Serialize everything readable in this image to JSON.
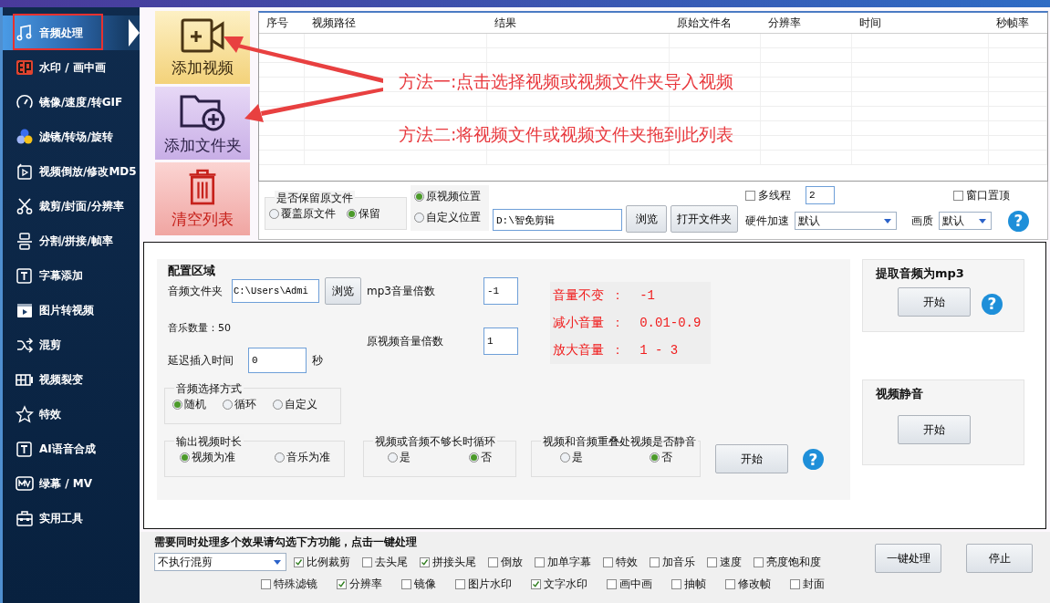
{
  "sidebar": {
    "highlight_selected": true,
    "items": [
      {
        "label": "音频处理",
        "selected": true
      },
      {
        "label": "水印 / 画中画",
        "selected": false
      },
      {
        "label": "镜像/速度/转GIF",
        "selected": false
      },
      {
        "label": "滤镜/转场/旋转",
        "selected": false
      },
      {
        "label": "视频倒放/修改MD5",
        "selected": false
      },
      {
        "label": "裁剪/封面/分辨率",
        "selected": false
      },
      {
        "label": "分割/拼接/帧率",
        "selected": false
      },
      {
        "label": "字幕添加",
        "selected": false
      },
      {
        "label": "图片转视频",
        "selected": false
      },
      {
        "label": "混剪",
        "selected": false
      },
      {
        "label": "视频裂变",
        "selected": false
      },
      {
        "label": "特效",
        "selected": false
      },
      {
        "label": "AI语音合成",
        "selected": false
      },
      {
        "label": "绿幕 / MV",
        "selected": false
      },
      {
        "label": "实用工具",
        "selected": false
      }
    ]
  },
  "actions": [
    {
      "label": "添加视频"
    },
    {
      "label": "添加文件夹"
    },
    {
      "label": "清空列表"
    }
  ],
  "table": {
    "columns": [
      "序号",
      "视频路径",
      "结果",
      "原始文件名",
      "分辨率",
      "时间",
      "秒帧率"
    ]
  },
  "annotations": [
    {
      "text": "方法一:点击选择视频或视频文件夹导入视频"
    },
    {
      "text": "方法二:将视频文件或视频文件夹拖到此列表"
    }
  ],
  "output_options": {
    "keep_original": {
      "title": "是否保留原文件",
      "options": [
        {
          "label": "覆盖原文件",
          "selected": false
        },
        {
          "label": "保留",
          "selected": true
        }
      ]
    },
    "location": {
      "options": [
        {
          "label": "原视频位置",
          "selected": true
        },
        {
          "label": "自定义位置",
          "selected": false
        }
      ],
      "path": "D:\\智免剪辑",
      "browse": "浏览",
      "open_folder": "打开文件夹"
    },
    "multithread": {
      "label": "多线程",
      "checked": false,
      "value": "2"
    },
    "window_top": {
      "label": "窗口置顶",
      "checked": false
    },
    "hw_accel": {
      "label": "硬件加速",
      "value": "默认"
    },
    "quality": {
      "label": "画质",
      "value": "默认"
    },
    "help": "?"
  },
  "config": {
    "title": "配置区域",
    "audio_folder": {
      "label": "音频文件夹",
      "value": "C:\\Users\\Admi",
      "browse": "浏览"
    },
    "music_count": "音乐数量：50",
    "delay": {
      "label": "延迟插入时间",
      "value": "0",
      "unit": "秒"
    },
    "mp3_volume": {
      "label": "mp3音量倍数",
      "value": "-1"
    },
    "orig_volume": {
      "label": "原视频音量倍数",
      "value": "1"
    },
    "volume_hints": [
      "音量不变 ：  -1",
      "减小音量 ：  0.01-0.9",
      "放大音量 ：  1 - 3"
    ],
    "audio_select": {
      "title": "音频选择方式",
      "options": [
        {
          "label": "随机",
          "selected": true
        },
        {
          "label": "循环",
          "selected": false
        },
        {
          "label": "自定义",
          "selected": false
        }
      ]
    },
    "output_duration": {
      "title": "输出视频时长",
      "options": [
        {
          "label": "视频为准",
          "selected": true
        },
        {
          "label": "音乐为准",
          "selected": false
        }
      ]
    },
    "loop_short": {
      "title": "视频或音频不够长时循环",
      "options": [
        {
          "label": "是",
          "selected": false
        },
        {
          "label": "否",
          "selected": true
        }
      ]
    },
    "mute_overlap": {
      "title": "视频和音频重叠处视频是否静音",
      "options": [
        {
          "label": "是",
          "selected": false
        },
        {
          "label": "否",
          "selected": true
        }
      ]
    },
    "start": "开始",
    "help": "?"
  },
  "extract_audio": {
    "title": "提取音频为mp3",
    "button": "开始",
    "help": "?"
  },
  "mute_video": {
    "title": "视频静音",
    "button": "开始"
  },
  "batch": {
    "hint": "需要同时处理多个效果请勾选下方功能，点击一键处理",
    "mix": "不执行混剪",
    "effects_row_1": [
      {
        "label": "比例裁剪",
        "checked": true
      },
      {
        "label": "去头尾",
        "checked": false
      },
      {
        "label": "拼接头尾",
        "checked": true
      },
      {
        "label": "倒放",
        "checked": false
      },
      {
        "label": "加单字幕",
        "checked": false
      },
      {
        "label": "特效",
        "checked": false
      },
      {
        "label": "加音乐",
        "checked": false
      },
      {
        "label": "速度",
        "checked": false
      },
      {
        "label": "亮度饱和度",
        "checked": false
      }
    ],
    "effects_row_2": [
      {
        "label": "特殊滤镜",
        "checked": false
      },
      {
        "label": "分辨率",
        "checked": true
      },
      {
        "label": "镜像",
        "checked": false
      },
      {
        "label": "图片水印",
        "checked": false
      },
      {
        "label": "文字水印",
        "checked": true
      },
      {
        "label": "画中画",
        "checked": false
      },
      {
        "label": "抽帧",
        "checked": false
      },
      {
        "label": "修改帧",
        "checked": false
      },
      {
        "label": "封面",
        "checked": false
      }
    ],
    "run": "一键处理",
    "stop": "停止"
  }
}
